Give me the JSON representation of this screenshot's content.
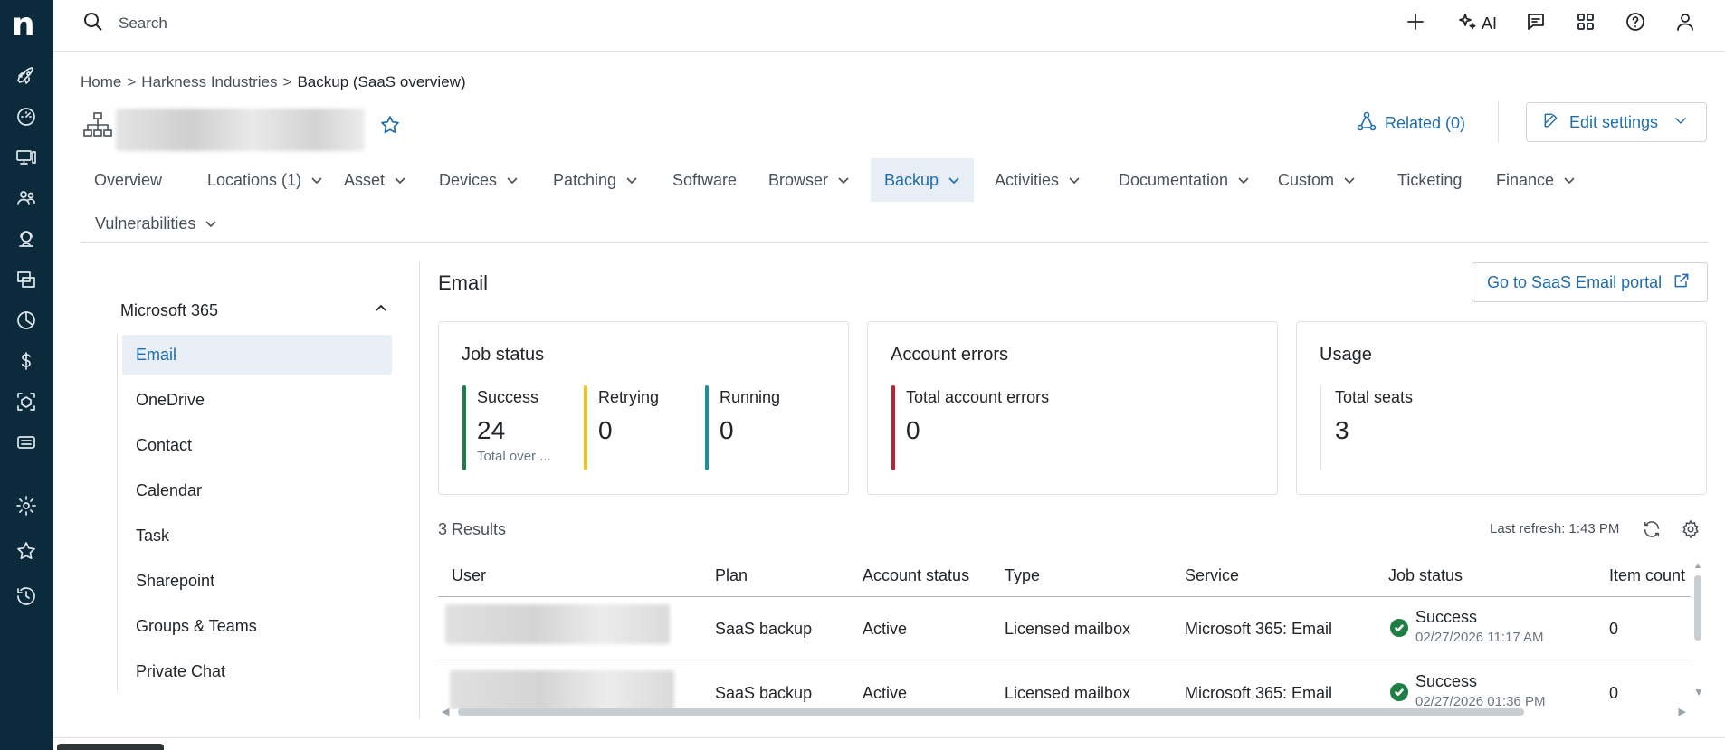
{
  "topbar": {
    "search_placeholder": "Search",
    "ai_label": "AI"
  },
  "breadcrumb": {
    "items": [
      "Home",
      "Harkness Industries",
      "Backup (SaaS overview)"
    ]
  },
  "header": {
    "related_label": "Related (0)",
    "edit_label": "Edit settings"
  },
  "tabs": [
    {
      "label": "Overview",
      "dropdown": false
    },
    {
      "label": "Locations (1)",
      "dropdown": true
    },
    {
      "label": "Asset",
      "dropdown": true
    },
    {
      "label": "Devices",
      "dropdown": true
    },
    {
      "label": "Patching",
      "dropdown": true
    },
    {
      "label": "Software",
      "dropdown": false
    },
    {
      "label": "Browser",
      "dropdown": true
    },
    {
      "label": "Backup",
      "dropdown": true,
      "active": true
    },
    {
      "label": "Activities",
      "dropdown": true
    },
    {
      "label": "Documentation",
      "dropdown": true
    },
    {
      "label": "Custom",
      "dropdown": true
    },
    {
      "label": "Ticketing",
      "dropdown": false
    },
    {
      "label": "Finance",
      "dropdown": true
    },
    {
      "label": "Vulnerabilities",
      "dropdown": true
    }
  ],
  "sidenav": {
    "group": "Microsoft 365",
    "items": [
      "Email",
      "OneDrive",
      "Contact",
      "Calendar",
      "Task",
      "Sharepoint",
      "Groups & Teams",
      "Private Chat"
    ],
    "active": "Email"
  },
  "main": {
    "title": "Email",
    "portal_label": "Go to SaaS Email portal",
    "cards": {
      "job_status": {
        "title": "Job status",
        "metrics": [
          {
            "label": "Success",
            "value": "24",
            "sub": "Total over ...",
            "color": "#1e7f46"
          },
          {
            "label": "Retrying",
            "value": "0",
            "sub": "",
            "color": "#f2c418"
          },
          {
            "label": "Running",
            "value": "0",
            "sub": "",
            "color": "#1b8ea4"
          }
        ]
      },
      "account_errors": {
        "title": "Account errors",
        "metrics": [
          {
            "label": "Total account errors",
            "value": "0",
            "color": "#c3202f"
          }
        ]
      },
      "usage": {
        "title": "Usage",
        "metrics": [
          {
            "label": "Total seats",
            "value": "3",
            "color": "#dee2e6"
          }
        ]
      }
    },
    "results_label": "3 Results",
    "last_refresh": "Last refresh: 1:43 PM"
  },
  "table": {
    "columns": [
      "User",
      "Plan",
      "Account status",
      "Type",
      "Service",
      "Job status",
      "Item count"
    ],
    "rows": [
      {
        "plan": "SaaS backup",
        "account_status": "Active",
        "type": "Licensed mailbox",
        "service": "Microsoft 365: Email",
        "job_status": "Success",
        "job_time": "02/27/2026 11:17 AM",
        "item_count": "0"
      },
      {
        "plan": "SaaS backup",
        "account_status": "Active",
        "type": "Licensed mailbox",
        "service": "Microsoft 365: Email",
        "job_status": "Success",
        "job_time": "02/27/2026 01:36 PM",
        "item_count": "0"
      }
    ]
  },
  "icons": {
    "rail": [
      "rocket-icon",
      "dashboard-icon",
      "devices-icon",
      "users-icon",
      "support-icon",
      "windows-icon",
      "reports-icon",
      "billing-icon",
      "packages-icon",
      "tickets-icon",
      "settings-icon",
      "favorites-icon",
      "history-icon"
    ]
  }
}
